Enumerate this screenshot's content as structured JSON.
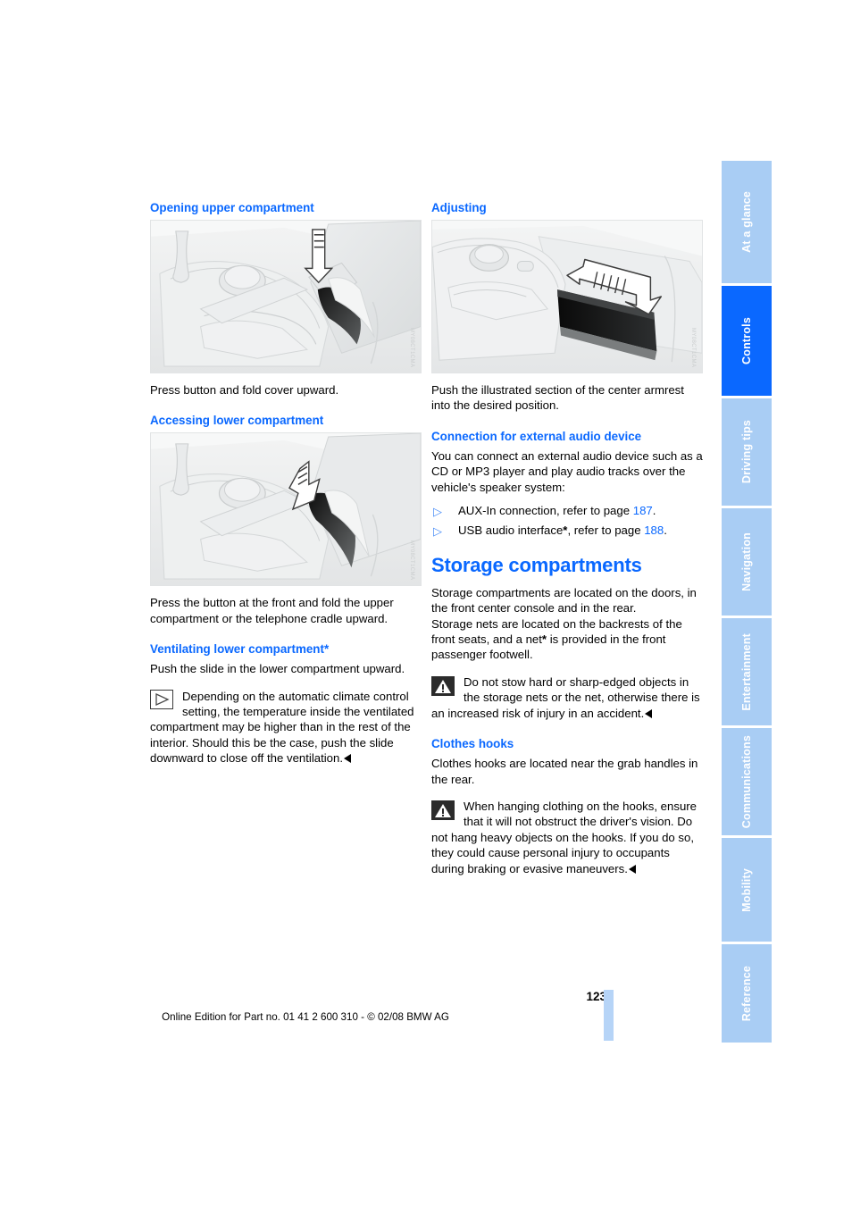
{
  "document": {
    "page_number": "123",
    "footer_note": "Online Edition for Part no. 01 41 2 600 310 - © 02/08 BMW AG",
    "accent_blue": "#0a68ff",
    "tab_inactive_blue": "#a9cdf4",
    "bullet_blue": "#4b8ef7"
  },
  "side_tabs": [
    {
      "label": "At a glance",
      "active": false
    },
    {
      "label": "Controls",
      "active": true
    },
    {
      "label": "Driving tips",
      "active": false
    },
    {
      "label": "Navigation",
      "active": false
    },
    {
      "label": "Entertainment",
      "active": false
    },
    {
      "label": "Communications",
      "active": false
    },
    {
      "label": "Mobility",
      "active": false
    },
    {
      "label": "Reference",
      "active": false
    }
  ],
  "left_column": {
    "section_1": {
      "heading": "Opening upper compartment",
      "figure_code": "MY08CT1CMA",
      "caption": "Press button and fold cover upward."
    },
    "section_2": {
      "heading": "Accessing lower compartment",
      "figure_code": "MY08CT1CMA",
      "caption": "Press the button at the front and fold the upper compartment or the telephone cradle upward."
    },
    "section_3": {
      "heading": "Ventilating lower compartment*",
      "body": "Push the slide in the lower compartment upward.",
      "note": "Depending on the automatic climate control setting, the temperature inside the ventilated compartment may be higher than in the rest of the interior. Should this be the case, push the slide downward to close off the ventilation."
    }
  },
  "right_column": {
    "section_1": {
      "heading": "Adjusting",
      "figure_code": "MY08CT1CMA",
      "caption": "Push the illustrated section of the center armrest into the desired position."
    },
    "section_2": {
      "heading": "Connection for external audio device",
      "body": "You can connect an external audio device such as a CD or MP3 player and play audio tracks over the vehicle's speaker system:",
      "items": [
        {
          "text_before": "AUX-In connection, refer to page ",
          "page": "187",
          "text_after": ".",
          "starred": false
        },
        {
          "text_before": "USB audio interface",
          "star": "*",
          "text_mid": ", refer to page ",
          "page": "188",
          "text_after": ".",
          "starred": true
        }
      ]
    },
    "section_3": {
      "heading": "Storage compartments",
      "body_1": "Storage compartments are located on the doors, in the front center console and in the rear.",
      "body_2_a": "Storage nets are located on the backrests of the front seats, and a net",
      "body_2_star": "*",
      "body_2_b": " is provided in the front passenger footwell.",
      "warning": "Do not stow hard or sharp-edged objects in the storage nets or the net, otherwise there is an increased risk of injury in an accident."
    },
    "section_4": {
      "heading": "Clothes hooks",
      "body": "Clothes hooks are located near the grab handles in the rear.",
      "warning": "When hanging clothing on the hooks, ensure that it will not obstruct the driver's vision. Do not hang heavy objects on the hooks. If you do so, they could cause personal injury to occupants during braking or evasive maneuvers."
    }
  },
  "icons": {
    "note": "note-triangle-icon",
    "warning": "warning-triangle-icon",
    "bullet": "triangle-bullet-icon",
    "end_of_note": "end-marker-icon"
  }
}
